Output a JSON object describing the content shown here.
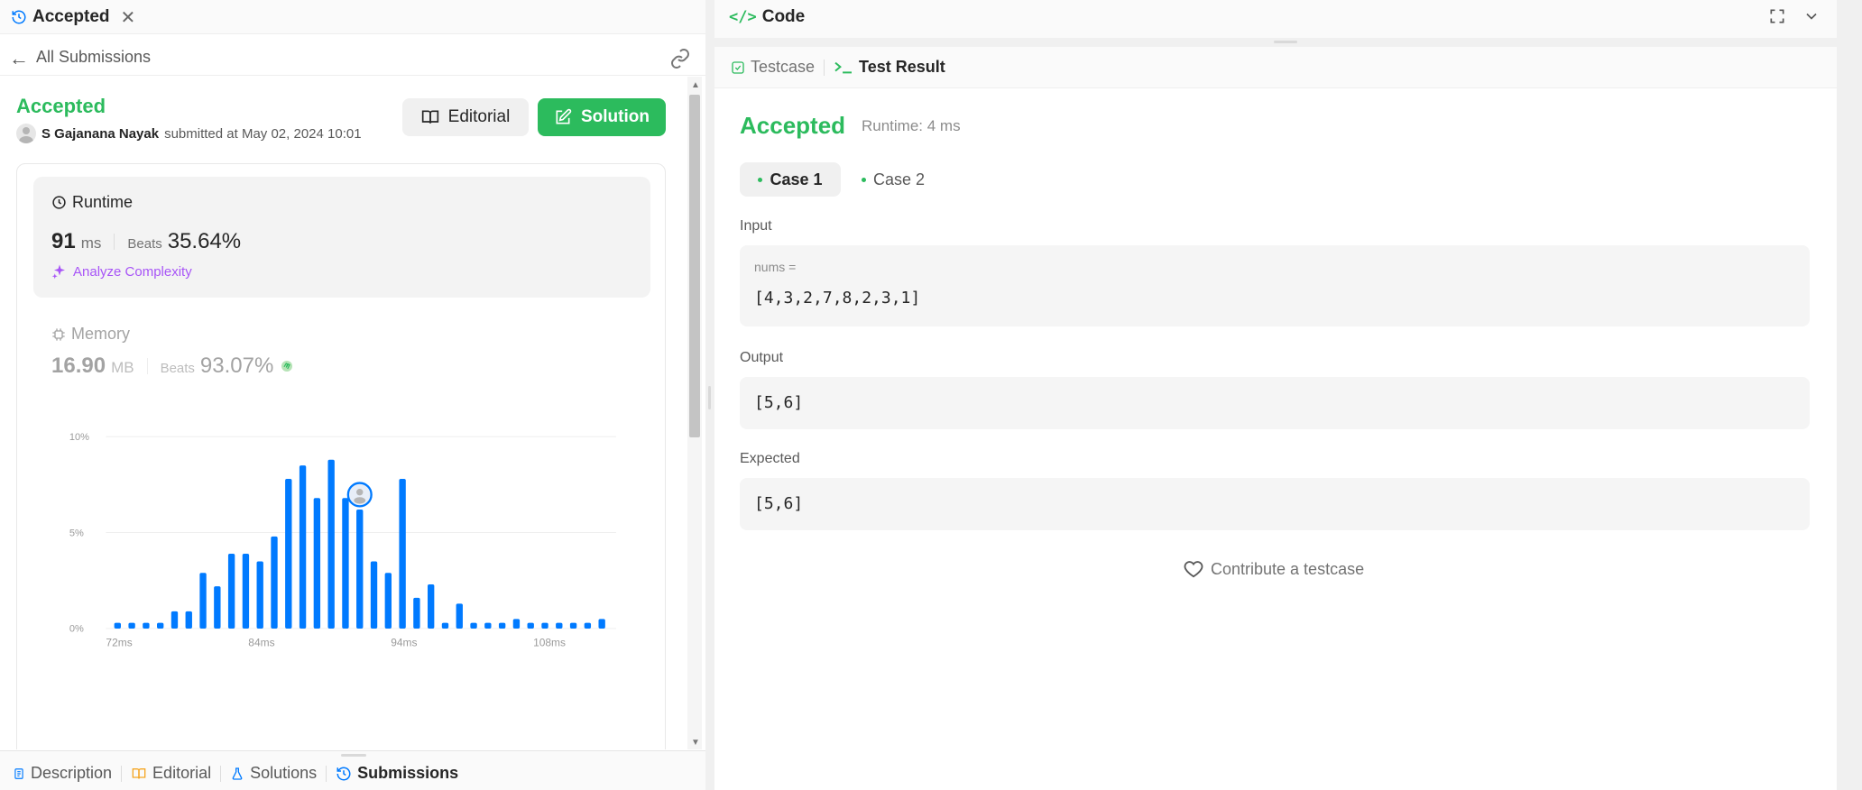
{
  "left": {
    "tab_title": "Accepted",
    "nav_label": "All Submissions",
    "status": "Accepted",
    "author": "S Gajanana Nayak",
    "submitted_text": "submitted at May 02, 2024 10:01",
    "editorial_btn": "Editorial",
    "solution_btn": "Solution",
    "runtime": {
      "label": "Runtime",
      "value": "91",
      "unit": "ms",
      "beats_label": "Beats",
      "beats_value": "35.64%",
      "analyze": "Analyze Complexity"
    },
    "memory": {
      "label": "Memory",
      "value": "16.90",
      "unit": "MB",
      "beats_label": "Beats",
      "beats_value": "93.07%"
    },
    "bottom_tabs": [
      "Description",
      "Editorial",
      "Solutions",
      "Submissions"
    ]
  },
  "chart_data": {
    "type": "bar",
    "y_ticks": [
      "10%",
      "5%",
      "0%"
    ],
    "x_ticks": [
      "72ms",
      "84ms",
      "94ms",
      "108ms"
    ],
    "ylim": [
      0,
      10
    ],
    "values": [
      0.3,
      0.3,
      0.3,
      0.3,
      0.9,
      0.9,
      2.9,
      2.2,
      3.9,
      3.9,
      3.5,
      4.8,
      7.8,
      8.5,
      6.8,
      8.8,
      6.8,
      6.2,
      3.5,
      2.9,
      7.8,
      1.6,
      2.3,
      0.3,
      1.3,
      0.3,
      0.3,
      0.3,
      0.5,
      0.3,
      0.3,
      0.3,
      0.3,
      0.3,
      0.5
    ],
    "highlight_index": 17,
    "color": "#007aff",
    "mini_color": "#d9d9d9"
  },
  "right": {
    "code_title": "Code",
    "tab_testcase": "Testcase",
    "tab_result": "Test Result",
    "status": "Accepted",
    "runtime": "Runtime: 4 ms",
    "cases": [
      "Case 1",
      "Case 2"
    ],
    "input_label": "Input",
    "input_var": "nums =",
    "input_value": "[4,3,2,7,8,2,3,1]",
    "output_label": "Output",
    "output_value": "[5,6]",
    "expected_label": "Expected",
    "expected_value": "[5,6]",
    "contribute": "Contribute a testcase"
  },
  "colors": {
    "accent_green": "#2cbb5d",
    "bar_blue": "#007aff",
    "analyze_purple": "#a855f7"
  }
}
